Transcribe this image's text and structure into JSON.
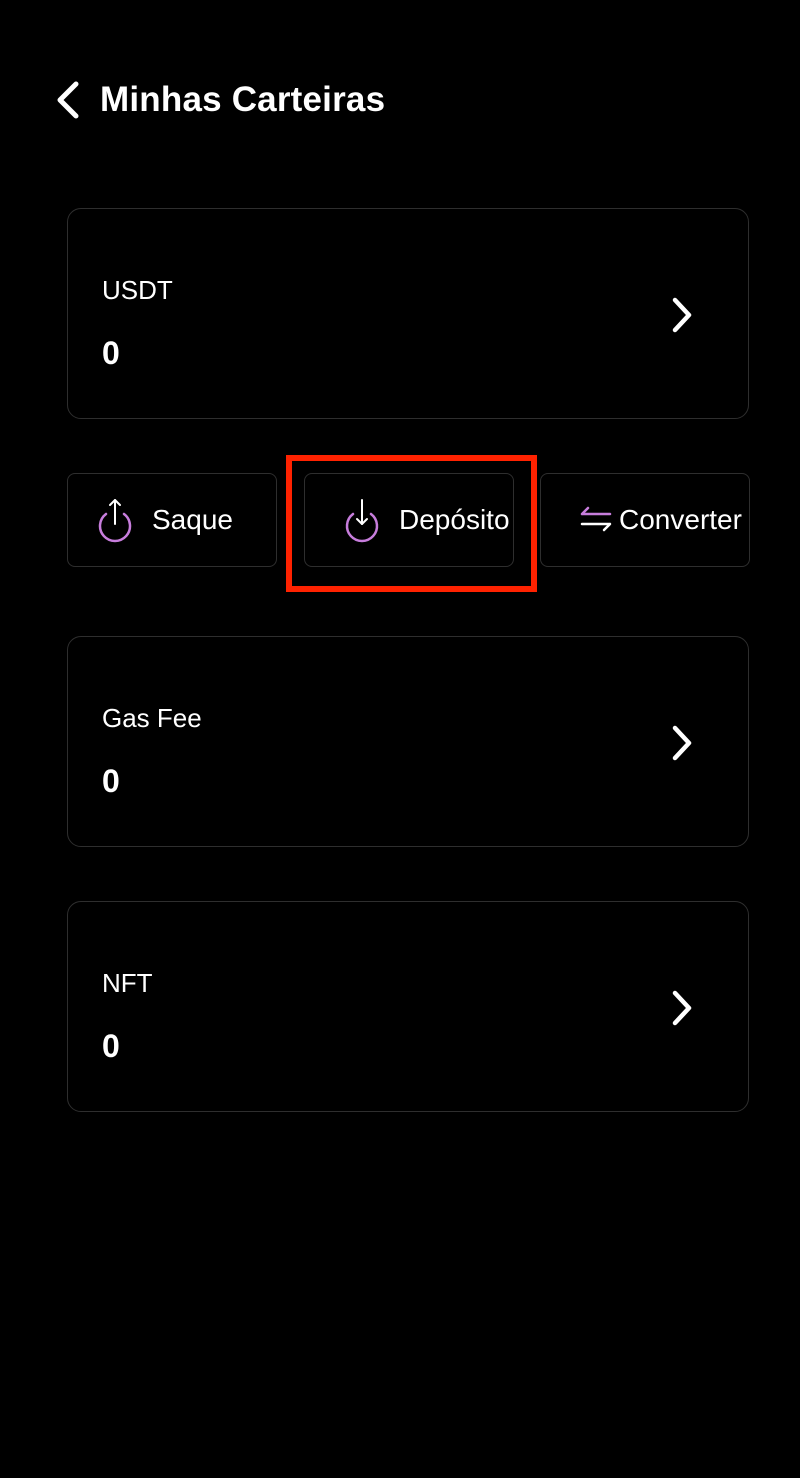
{
  "header": {
    "title": "Minhas Carteiras",
    "back_icon": "chevron-left-icon"
  },
  "wallets": [
    {
      "name": "USDT",
      "amount": "0",
      "chevron_icon": "chevron-right-icon"
    },
    {
      "name": "Gas Fee",
      "amount": "0",
      "chevron_icon": "chevron-right-icon"
    },
    {
      "name": "NFT",
      "amount": "0",
      "chevron_icon": "chevron-right-icon"
    }
  ],
  "actions": [
    {
      "label": "Saque",
      "icon": "withdraw-icon"
    },
    {
      "label": "Depósito",
      "icon": "deposit-icon",
      "highlighted": true
    },
    {
      "label": "Converter",
      "icon": "convert-icon"
    }
  ],
  "colors": {
    "background": "#000000",
    "card_border": "#2e2e2e",
    "accent_purple": "#c77ddc",
    "highlight_red": "#ff2200"
  }
}
